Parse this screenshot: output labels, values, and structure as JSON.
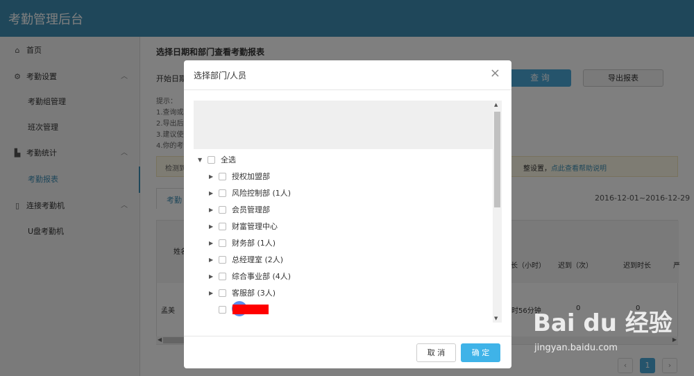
{
  "app": {
    "title": "考勤管理后台"
  },
  "sidebar": {
    "items": [
      {
        "label": "首页",
        "icon": "home-icon"
      },
      {
        "label": "考勤设置",
        "icon": "settings-icon"
      },
      {
        "label": "考勤组管理"
      },
      {
        "label": "班次管理"
      },
      {
        "label": "考勤统计",
        "icon": "chart-icon"
      },
      {
        "label": "考勤报表"
      },
      {
        "label": "连接考勤机",
        "icon": "device-icon"
      },
      {
        "label": "U盘考勤机"
      }
    ]
  },
  "main": {
    "page_title": "选择日期和部门查看考勤报表",
    "start_date_label": "开始日期",
    "query_button": "查 询",
    "export_button": "导出报表",
    "tips": [
      "提示：",
      "1.查询或",
      "2.导出后",
      "3.建议使",
      "4.你的考"
    ],
    "notice_left": "检测到",
    "notice_right_prefix": "整设置，",
    "notice_right_link": "点此查看帮助说明",
    "tab_label": "考勤",
    "date_range": "2016-12-01~2016-12-29",
    "table": {
      "headers": [
        "姓名",
        "长（小时）",
        "迟到（次）",
        "迟到时长",
        "严"
      ],
      "row": {
        "name": "孟美",
        "duration": "时56分钟",
        "late_count": "0",
        "late_duration": "0"
      }
    },
    "pagination": {
      "current": "1",
      "prev": "‹",
      "next": "›"
    }
  },
  "modal": {
    "title": "选择部门/人员",
    "close": "×",
    "select_all": "全选",
    "departments": [
      "授权加盟部",
      "风险控制部 (1人)",
      "会员管理部",
      "财富管理中心",
      "财务部 (1人)",
      "总经理室 (2人)",
      "综合事业部 (4人)",
      "客服部 (3人)"
    ],
    "cancel_button": "取 消",
    "ok_button": "确 定"
  },
  "watermark": {
    "brand": "Bai du 经验",
    "url": "jingyan.baidu.com"
  },
  "colors": {
    "topbar": "#3f8fb5",
    "accent": "#3fb3e8",
    "redaction": "#ff0000"
  }
}
